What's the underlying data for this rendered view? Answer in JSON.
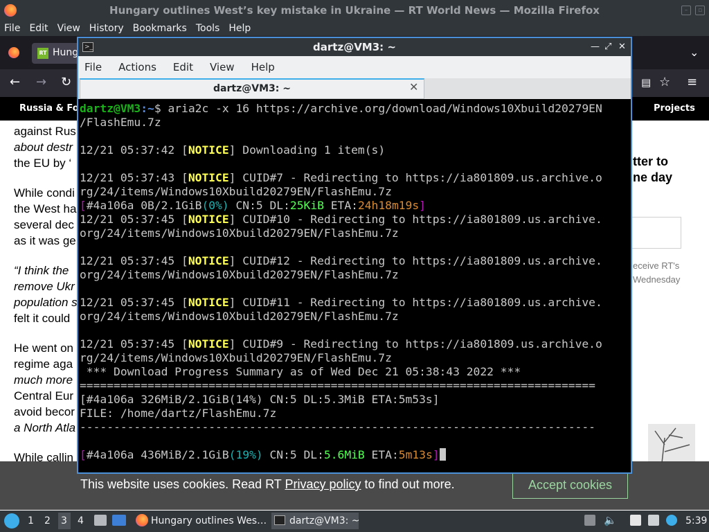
{
  "firefox": {
    "window_title": "Hungary outlines West’s key mistake in Ukraine — RT World News — Mozilla Firefox",
    "menu": [
      "File",
      "Edit",
      "View",
      "History",
      "Bookmarks",
      "Tools",
      "Help"
    ],
    "tab_label": "Hung",
    "tab_favicon": "RT"
  },
  "rt_nav": {
    "left": "Russia & For",
    "right": "Projects"
  },
  "article": {
    "lines": [
      "against Rus",
      "about destr",
      "the EU by ‘",
      "While condi",
      "the West ha",
      "several dec",
      "as it was ge",
      "“I think the",
      "remove Ukr",
      "population s",
      "felt it could",
      "He went on",
      "regime aga",
      "much more",
      "Central Eur",
      "avoid becor",
      "a North Atla",
      "While callin"
    ]
  },
  "sidebar": {
    "headline_1": "tter to",
    "headline_2": "ne day",
    "note_1": "eceive RT's",
    "note_2": "Wednesday"
  },
  "cookie": {
    "prefix": "This website uses cookies. Read RT ",
    "link": "Privacy policy",
    "suffix": " to find out more.",
    "button": "Accept cookies"
  },
  "terminal": {
    "window_title": "dartz@VM3: ~",
    "menu": [
      "File",
      "Actions",
      "Edit",
      "View",
      "Help"
    ],
    "tab_title": "dartz@VM3: ~",
    "prompt_user": "dartz@VM3",
    "prompt_path": ":~",
    "prompt_sym": "$ ",
    "command_1": "aria2c -x 16 https://archive.org/download/Windows10Xbuild20279EN",
    "command_2": "/FlashEmu.7z",
    "t1": "12/21 05:37:42 [",
    "notice": "NOTICE",
    "m1": "] Downloading 1 item(s)",
    "t2": "12/21 05:37:43 [",
    "m2a": "] CUID#7 - Redirecting to https://ia801809.us.archive.o",
    "m2b": "rg/24/items/Windows10Xbuild20279EN/FlashEmu.7z",
    "p1_open": "[",
    "p1_id": "#4a106a 0B/2.1GiB",
    "p1_pct": "(0%)",
    "p1_cn": " CN:5 DL:",
    "p1_dl": "25KiB",
    "p1_eta": " ETA:",
    "p1_etav": "24h18m19s",
    "p1_close": "]",
    "t3": "12/21 05:37:45 [",
    "m3a": "] CUID#10 - Redirecting to https://ia801809.us.archive.",
    "m3b": "org/24/items/Windows10Xbuild20279EN/FlashEmu.7z",
    "t4": "12/21 05:37:45 [",
    "m4a": "] CUID#12 - Redirecting to https://ia801809.us.archive.",
    "m4b": "org/24/items/Windows10Xbuild20279EN/FlashEmu.7z",
    "t5": "12/21 05:37:45 [",
    "m5a": "] CUID#11 - Redirecting to https://ia801809.us.archive.",
    "m5b": "org/24/items/Windows10Xbuild20279EN/FlashEmu.7z",
    "t6": "12/21 05:37:45 [",
    "m6a": "] CUID#9 - Redirecting to https://ia801809.us.archive.o",
    "m6b": "rg/24/items/Windows10Xbuild20279EN/FlashEmu.7z",
    "summary": " *** Download Progress Summary as of Wed Dec 21 05:38:43 2022 ***",
    "rule_eq": "============================================================================",
    "sum_line": "[#4a106a 326MiB/2.1GiB(14%) CN:5 DL:5.3MiB ETA:5m53s]",
    "file_line": "FILE: /home/dartz/FlashEmu.7z",
    "rule_dash": "----------------------------------------------------------------------------",
    "p2_open": "[",
    "p2_id": "#4a106a 436MiB/2.1GiB",
    "p2_pct": "(19%)",
    "p2_cn": " CN:5 DL:",
    "p2_dl": "5.6MiB",
    "p2_eta": " ETA:",
    "p2_etav": "5m13s",
    "p2_close": "]"
  },
  "taskbar": {
    "workspaces": [
      "1",
      "2",
      "3",
      "4"
    ],
    "task_firefox": "Hungary outlines Wes…",
    "task_terminal": "dartz@VM3: ~",
    "clock": "5:39"
  }
}
